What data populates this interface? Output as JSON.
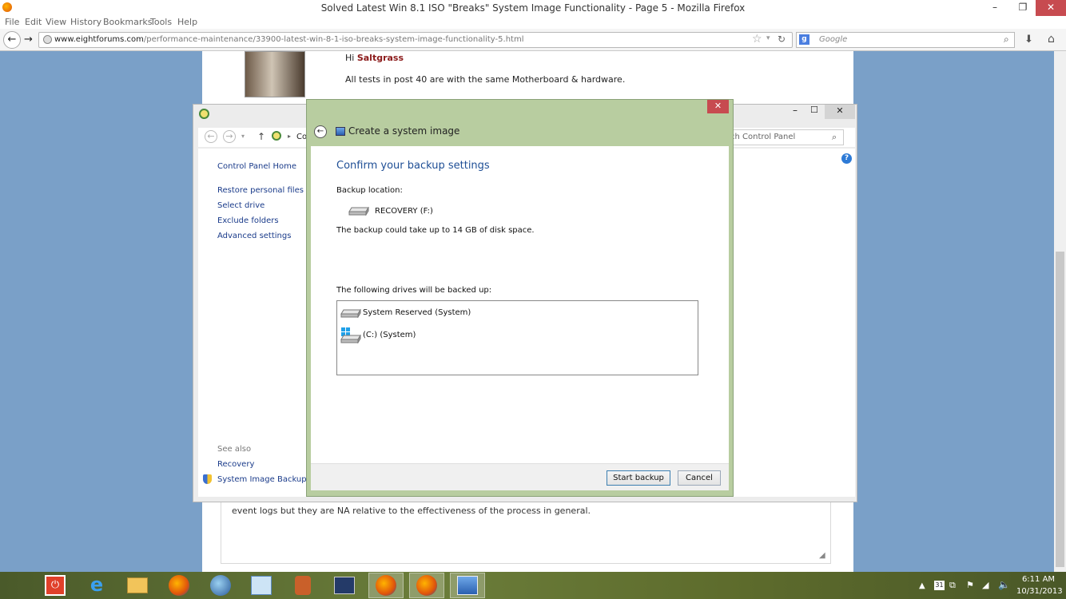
{
  "firefox": {
    "title": "Solved Latest Win 8.1 ISO \"Breaks\" System Image Functionality - Page 5 - Mozilla Firefox",
    "menu": [
      "File",
      "Edit",
      "View",
      "History",
      "Bookmarks",
      "Tools",
      "Help"
    ],
    "url_domain": "www.eightforums.com",
    "url_path": "/performance-maintenance/33900-latest-win-8-1-iso-breaks-system-image-functionality-5.html",
    "search_placeholder": "Google"
  },
  "page": {
    "greeting_prefix": "Hi ",
    "greeting_name": "Saltgrass",
    "post_line": "All tests in post 40 are with the same Motherboard & hardware.",
    "post_text": "event logs but they are NA relative to the effectiveness of the process in general."
  },
  "control_panel": {
    "address_crumb": "Co",
    "search_placeholder": "ch Control Panel",
    "home_link": "Control Panel Home",
    "links": [
      "Restore personal files",
      "Select drive",
      "Exclude folders",
      "Advanced settings"
    ],
    "see_also": "See also",
    "see_also_links": [
      "Recovery",
      "System Image Backup"
    ]
  },
  "dialog": {
    "title": "Create a system image",
    "heading": "Confirm your backup settings",
    "backup_location_label": "Backup location:",
    "backup_location": "RECOVERY (F:)",
    "space_note": "The backup could take up to 14 GB of disk space.",
    "drives_label": "The following drives will be backed up:",
    "drives": [
      "System Reserved (System)",
      "(C:) (System)"
    ],
    "start_button": "Start backup",
    "cancel_button": "Cancel"
  },
  "taskbar": {
    "time": "6:11 AM",
    "date": "10/31/2013"
  }
}
